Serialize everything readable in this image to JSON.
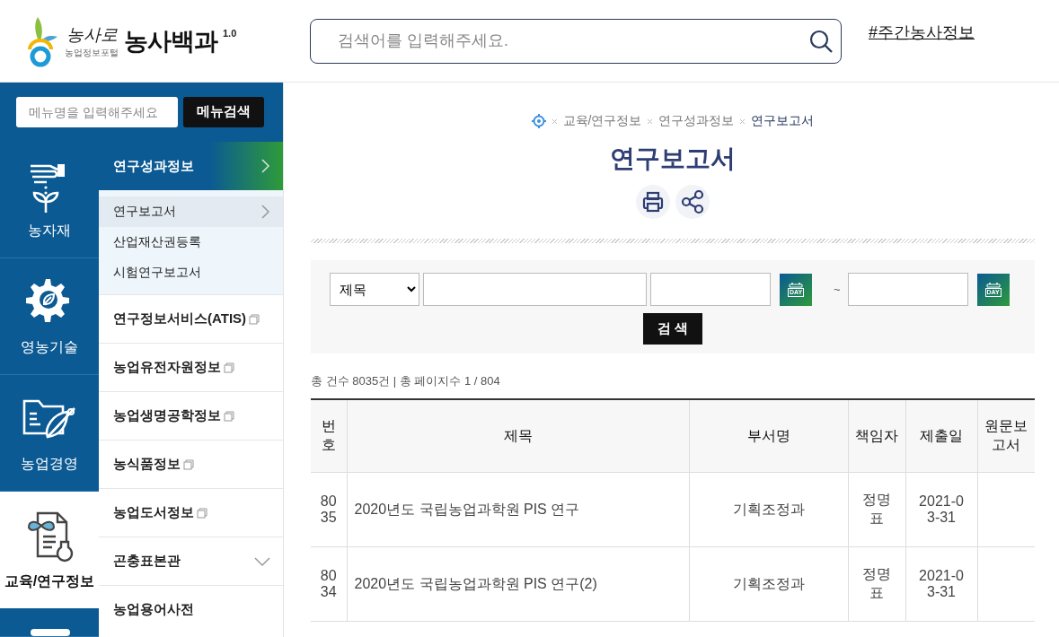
{
  "header": {
    "logo_script": "농사로",
    "logo_tagline": "농업정보포털",
    "logo_title": "농사백과",
    "logo_version": "1.0",
    "search": {
      "placeholder": "검색어를 입력해주세요."
    },
    "link": "#주간농사정보"
  },
  "sidebar": {
    "menu_search": {
      "placeholder": "메뉴명을 입력해주세요",
      "button": "메뉴검색"
    },
    "categories": [
      {
        "label": "농자재",
        "selected": false
      },
      {
        "label": "영농기술",
        "selected": false
      },
      {
        "label": "농업경영",
        "selected": false
      },
      {
        "label": "교육/연구정보",
        "selected": true
      },
      {
        "selected": false
      }
    ],
    "submenu": [
      {
        "label": "연구성과정보",
        "kind": "section",
        "children": [
          {
            "label": "연구보고서",
            "selected": true
          },
          {
            "label": "산업재산권등록",
            "selected": false
          },
          {
            "label": "시험연구보고서",
            "selected": false
          }
        ]
      },
      {
        "label": "연구정보서비스(ATIS)",
        "kind": "external"
      },
      {
        "label": "농업유전자원정보",
        "kind": "external"
      },
      {
        "label": "농업생명공학정보",
        "kind": "external"
      },
      {
        "label": "농식품정보",
        "kind": "external"
      },
      {
        "label": "농업도서정보",
        "kind": "external"
      },
      {
        "label": "곤충표본관",
        "kind": "dropdown"
      },
      {
        "label": "농업용어사전",
        "kind": "plain"
      }
    ]
  },
  "main": {
    "breadcrumb": [
      "교육/연구정보",
      "연구성과정보",
      "연구보고서"
    ],
    "title": "연구보고서",
    "filters": {
      "field": "제목",
      "date_buttons": [
        "DAY",
        "DAY"
      ],
      "separator": "~",
      "search_button": "검 색"
    },
    "count": "총 건수 8035건 | 총 페이지수 1 / 804",
    "table": {
      "columns": [
        "번호",
        "제목",
        "부서명",
        "책임자",
        "제출일",
        "원문보고서"
      ],
      "rows": [
        [
          "8035",
          "2020년도 국립농업과학원 PIS 연구",
          "기획조정과",
          "정명표",
          "2021-03-31",
          ""
        ],
        [
          "8034",
          "2020년도 국립농업과학원 PIS 연구(2)",
          "기획조정과",
          "정명표",
          "2021-03-31",
          ""
        ]
      ]
    }
  }
}
